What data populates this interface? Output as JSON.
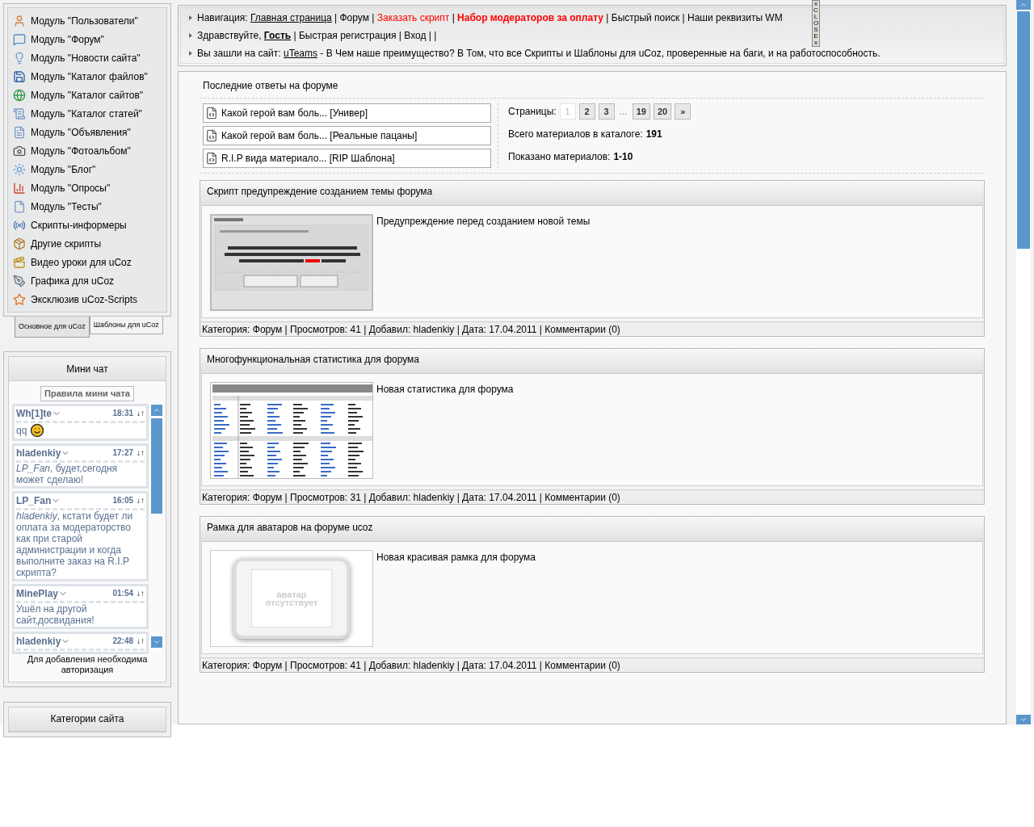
{
  "sidebar_menu": {
    "items": [
      {
        "label": "Модуль \"Пользователи\""
      },
      {
        "label": "Модуль \"Форум\""
      },
      {
        "label": "Модуль \"Новости сайта\""
      },
      {
        "label": "Модуль \"Каталог файлов\""
      },
      {
        "label": "Модуль \"Каталог сайтов\""
      },
      {
        "label": "Модуль \"Каталог статей\""
      },
      {
        "label": "Модуль \"Объявления\""
      },
      {
        "label": "Модуль \"Фотоальбом\""
      },
      {
        "label": "Модуль \"Блог\""
      },
      {
        "label": "Модуль \"Опросы\""
      },
      {
        "label": "Модуль \"Тесты\""
      },
      {
        "label": "Скрипты-информеры"
      },
      {
        "label": "Другие скрипты"
      },
      {
        "label": "Видео уроки для uCoz"
      },
      {
        "label": "Графика для uCoz"
      },
      {
        "label": "Эксклюзив uCoz-Scripts"
      }
    ],
    "tabs": [
      {
        "label": "Основное для uCoz",
        "selected": true
      },
      {
        "label": "Шаблоны для uCoz",
        "selected": false
      }
    ]
  },
  "mini_chat": {
    "title": "Мини чат",
    "rules_button": "Правила мини чата",
    "messages": [
      {
        "author": "Wh[1]te",
        "time": "18:31",
        "arrows": "↓↑",
        "text": "qq",
        "smiley": true
      },
      {
        "author": "hladenkiy",
        "time": "17:27",
        "arrows": "↓↑",
        "text": "*LP_Fan*, будет,сегодня может сделаю!",
        "smiley": false
      },
      {
        "author": "LP_Fan",
        "time": "16:05",
        "arrows": "↓↑",
        "text": "*hladenkiy*, кстати будет ли оплата за модераторство как при старой администрации и когда выполните заказ на R.I.P скрипта?",
        "smiley": false
      },
      {
        "author": "MinePlay",
        "time": "01:54",
        "arrows": "↓↑",
        "text": "Ушёл на другой сайт,досвидания!",
        "smiley": false
      },
      {
        "author": "hladenkiy",
        "time": "22:48",
        "arrows": "↓↑",
        "smiley": false
      }
    ],
    "note": "Для добавления необходима авторизация"
  },
  "categories": {
    "title": "Категории сайта"
  },
  "close_tab": {
    "text": "xCLOSEx"
  },
  "navigation": [
    [
      {
        "text": "Навигация: ",
        "kind": "plain"
      },
      {
        "text": "Главная страница",
        "kind": "link"
      },
      {
        "text": " | Форум | ",
        "kind": "plain"
      },
      {
        "text": "Заказать скрипт",
        "kind": "highlight"
      },
      {
        "text": " | ",
        "kind": "plain"
      },
      {
        "text": "Набор модераторов за оплату",
        "kind": "accent"
      },
      {
        "text": " | Быстрый поиск | Наши реквизиты WM",
        "kind": "plain"
      }
    ],
    [
      {
        "text": "Здравствуйте, ",
        "kind": "plain"
      },
      {
        "text": "Гость",
        "kind": "user"
      },
      {
        "text": " | Быстрая регистрация | Вход | |",
        "kind": "plain"
      }
    ],
    [
      {
        "text": "Вы зашли на сайт: ",
        "kind": "plain"
      },
      {
        "text": "uTeams",
        "kind": "link"
      },
      {
        "text": " - В Чем наше преимущество? В Том, что все Скрипты и Шаблоны для uCoz, проверенные на баги, и на работоспособность.",
        "kind": "plain"
      }
    ]
  ],
  "forum_replies": {
    "title": "Последние ответы на форуме",
    "items": [
      "Какой герой вам боль... [Универ]",
      "Какой герой вам боль... [Реальные пацаны]",
      "R.I.P вида материало... [RIP Шаблона]"
    ]
  },
  "pagination": {
    "label": "Страницы:",
    "pages": [
      {
        "text": "1",
        "kind": "page",
        "selected": true
      },
      {
        "text": "2",
        "kind": "page",
        "selected": false
      },
      {
        "text": "3",
        "kind": "page",
        "selected": false
      },
      {
        "text": "...",
        "kind": "gap"
      },
      {
        "text": "19",
        "kind": "page",
        "selected": false
      },
      {
        "text": "20",
        "kind": "page",
        "selected": false
      },
      {
        "text": "»",
        "kind": "page",
        "selected": false
      }
    ],
    "total_label": "Всего материалов в каталоге:",
    "total": "191",
    "shown_label": "Показано материалов:",
    "shown": "1-10"
  },
  "articles": [
    {
      "title": "Скрипт предупреждение созданием темы форума",
      "description": "Предупреждение перед созданием новой темы",
      "thumb": {
        "kind": "dialog"
      },
      "meta": "Категория: Форум | Просмотров: 41 | Добавил: hladenkiy | Дата: 17.04.2011 | Комментарии (0)"
    },
    {
      "title": "Многофункциональная статистика для форума",
      "description": "Новая статистика для форума",
      "thumb": {
        "kind": "table"
      },
      "meta": "Категория: Форум | Просмотров: 31 | Добавил: hladenkiy | Дата: 17.04.2011 | Комментарии (0)"
    },
    {
      "title": "Рамка для аватаров на форуме ucoz",
      "description": "Новая красивая рамка для форума",
      "thumb": {
        "kind": "avatar",
        "text": "аватар отсутствует"
      },
      "meta": "Категория: Форум | Просмотров: 41 | Добавил: hladenkiy | Дата: 17.04.2011 | Комментарии (0)"
    }
  ]
}
